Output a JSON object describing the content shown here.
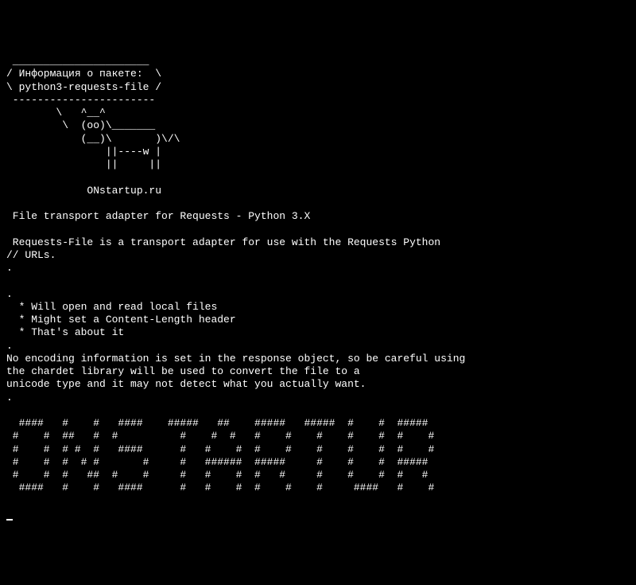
{
  "cowsay": {
    "border_top": " ______________________",
    "line1": "/ Информация о пакете:  \\",
    "line2": "\\ python3-requests-file /",
    "border_bottom": " -----------------------",
    "cow1": "        \\   ^__^",
    "cow2": "         \\  (oo)\\_______",
    "cow3": "            (__)\\       )\\/\\",
    "cow4": "                ||----w |",
    "cow5": "                ||     ||"
  },
  "site": "             ONstartup.ru",
  "heading": " File transport adapter for Requests - Python 3.X",
  "desc1": " Requests-File is a transport adapter for use with the Requests Python",
  "desc2": "// URLs.",
  "dot": ".",
  "feat1": "  * Will open and read local files",
  "feat2": "  * Might set a Content-Length header",
  "feat3": "  * That's about it",
  "enc1": "No encoding information is set in the response object, so be careful using",
  "enc2": "the chardet library will be used to convert the file to a",
  "enc3": "unicode type and it may not detect what you actually want.",
  "banner": {
    "l1": "  ####   #    #   ####    #####   ##    #####   #####  #    #  #####",
    "l2": " #    #  ##   #  #          #    #  #   #    #    #    #    #  #    #",
    "l3": " #    #  # #  #   ####      #   #    #  #    #    #    #    #  #    #",
    "l4": " #    #  #  # #       #     #   ######  #####     #    #    #  #####",
    "l5": " #    #  #   ##  #    #     #   #    #  #   #     #    #    #  #   #",
    "l6": "  ####   #    #   ####      #   #    #  #    #    #     ####   #    #"
  }
}
